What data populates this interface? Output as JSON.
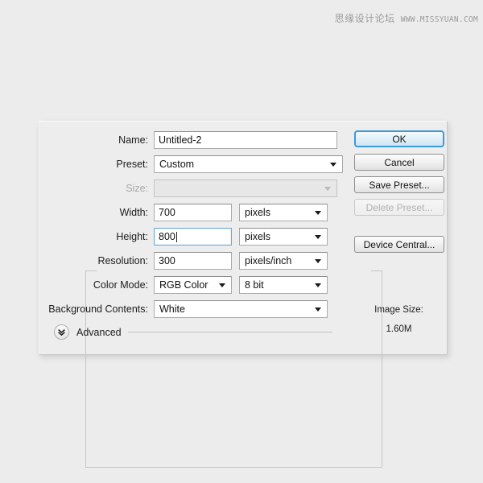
{
  "watermark": {
    "cn_text": "思缘设计论坛",
    "url_text": "WWW.MISSYUAN.COM"
  },
  "dialog": {
    "fields": {
      "name": {
        "label": "Name:",
        "value": "Untitled-2"
      },
      "preset": {
        "label": "Preset:",
        "value": "Custom"
      },
      "size": {
        "label": "Size:",
        "value": ""
      },
      "width": {
        "label": "Width:",
        "value": "700",
        "unit": "pixels"
      },
      "height": {
        "label": "Height:",
        "value": "800",
        "unit": "pixels"
      },
      "resolution": {
        "label": "Resolution:",
        "value": "300",
        "unit": "pixels/inch"
      },
      "color_mode": {
        "label": "Color Mode:",
        "value": "RGB Color",
        "depth": "8 bit"
      },
      "background_contents": {
        "label": "Background Contents:",
        "value": "White"
      }
    },
    "advanced": {
      "label": "Advanced",
      "icon": "chevron-double-down-icon"
    },
    "buttons": {
      "ok": "OK",
      "cancel": "Cancel",
      "save_preset": "Save Preset...",
      "delete_preset": "Delete Preset...",
      "device_central": "Device Central..."
    },
    "image_size": {
      "label": "Image Size:",
      "value": "1.60M"
    }
  },
  "colors": {
    "page_background": "#ececec",
    "dialog_background": "#ededed",
    "focus_blue": "#3b9ada",
    "input_border": "#a9a9a9",
    "disabled_text": "#b0b0b0"
  }
}
